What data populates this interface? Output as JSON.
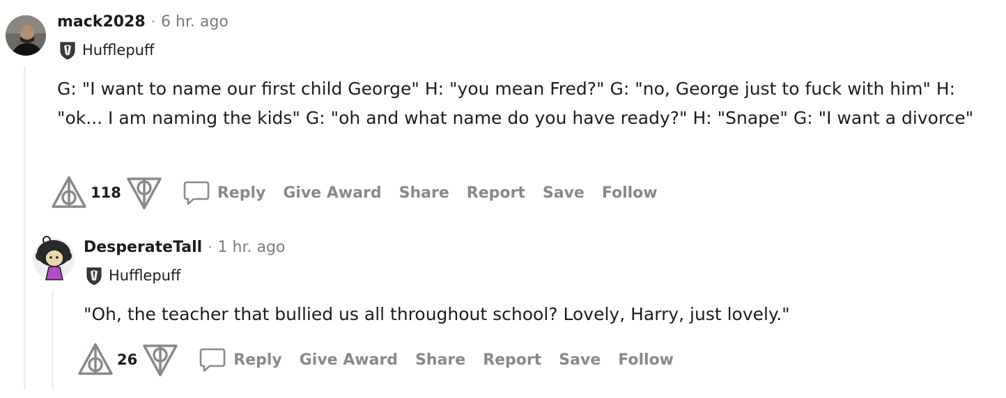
{
  "comments": [
    {
      "author": "mack2028",
      "separator": "·",
      "time": "6 hr. ago",
      "flair": "Hufflepuff",
      "body": "G: \"I want to name our first child George\" H: \"you mean Fred?\" G: \"no, George just to fuck with him\" H: \"ok... I am naming the kids\" G: \"oh and what name do you have ready?\" H: \"Snape\" G: \"I want a divorce\"",
      "score": "118",
      "actions": {
        "reply": "Reply",
        "give_award": "Give Award",
        "share": "Share",
        "report": "Report",
        "save": "Save",
        "follow": "Follow"
      }
    },
    {
      "author": "DesperateTall",
      "separator": "·",
      "time": "1 hr. ago",
      "flair": "Hufflepuff",
      "body": "\"Oh, the teacher that bullied us all throughout school? Lovely, Harry, just lovely.\"",
      "score": "26",
      "actions": {
        "reply": "Reply",
        "give_award": "Give Award",
        "share": "Share",
        "report": "Report",
        "save": "Save",
        "follow": "Follow"
      }
    }
  ],
  "icons": {
    "upvote": "deathly-hallows-upvote-icon",
    "downvote": "deathly-hallows-downvote-icon",
    "reply": "speech-bubble-icon",
    "flair": "badger-crest-icon"
  },
  "colors": {
    "action_text": "#878a8c",
    "thread_line": "#edeff1",
    "primary_text": "#1c1c1c"
  }
}
